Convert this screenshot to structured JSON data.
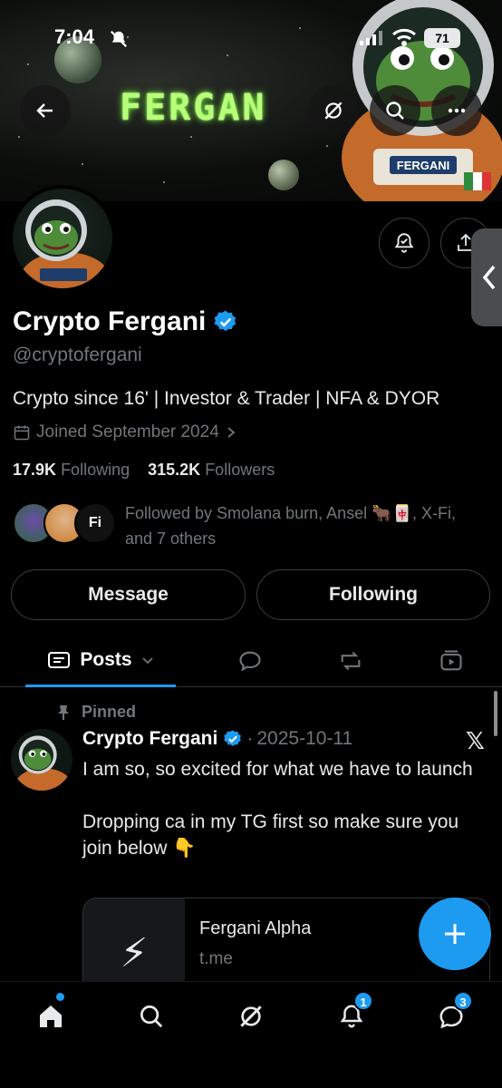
{
  "status_bar": {
    "time": "7:04",
    "battery": "71"
  },
  "banner": {
    "title": "FERGAN",
    "suit_label": "FERGANI"
  },
  "profile": {
    "name": "Crypto Fergani",
    "handle": "@cryptofergani",
    "bio": "Crypto since 16' | Investor & Trader | NFA & DYOR",
    "joined": "Joined September 2024",
    "following_count": "17.9K",
    "following_label": "Following",
    "followers_count": "315.2K",
    "followers_label": "Followers",
    "followed_by": "Followed by Smolana burn, Ansel 🐂🀄, X-Fi, and 7 others",
    "mutual_third": "Fi"
  },
  "actions": {
    "message": "Message",
    "following": "Following"
  },
  "tabs": {
    "posts": "Posts"
  },
  "post": {
    "pinned_label": "Pinned",
    "author": "Crypto Fergani",
    "separator": "·",
    "date": "2025-10-11",
    "text_line1": "I am so, so excited for what we have to launch",
    "text_line2": "Dropping ca in my TG first so make sure you join below 👇",
    "card": {
      "emoji": "⚡",
      "title": "Fergani Alpha",
      "domain": "t.me"
    }
  },
  "bottom_nav": {
    "items": [
      "home-icon",
      "search-icon",
      "grok-icon",
      "notifications-icon",
      "messages-icon"
    ],
    "notifications_badge": "1",
    "messages_badge": "3"
  },
  "colors": {
    "accent": "#1d9bf0",
    "muted": "#71767b",
    "background": "#000000",
    "banner_text": "#b8ff7a"
  }
}
